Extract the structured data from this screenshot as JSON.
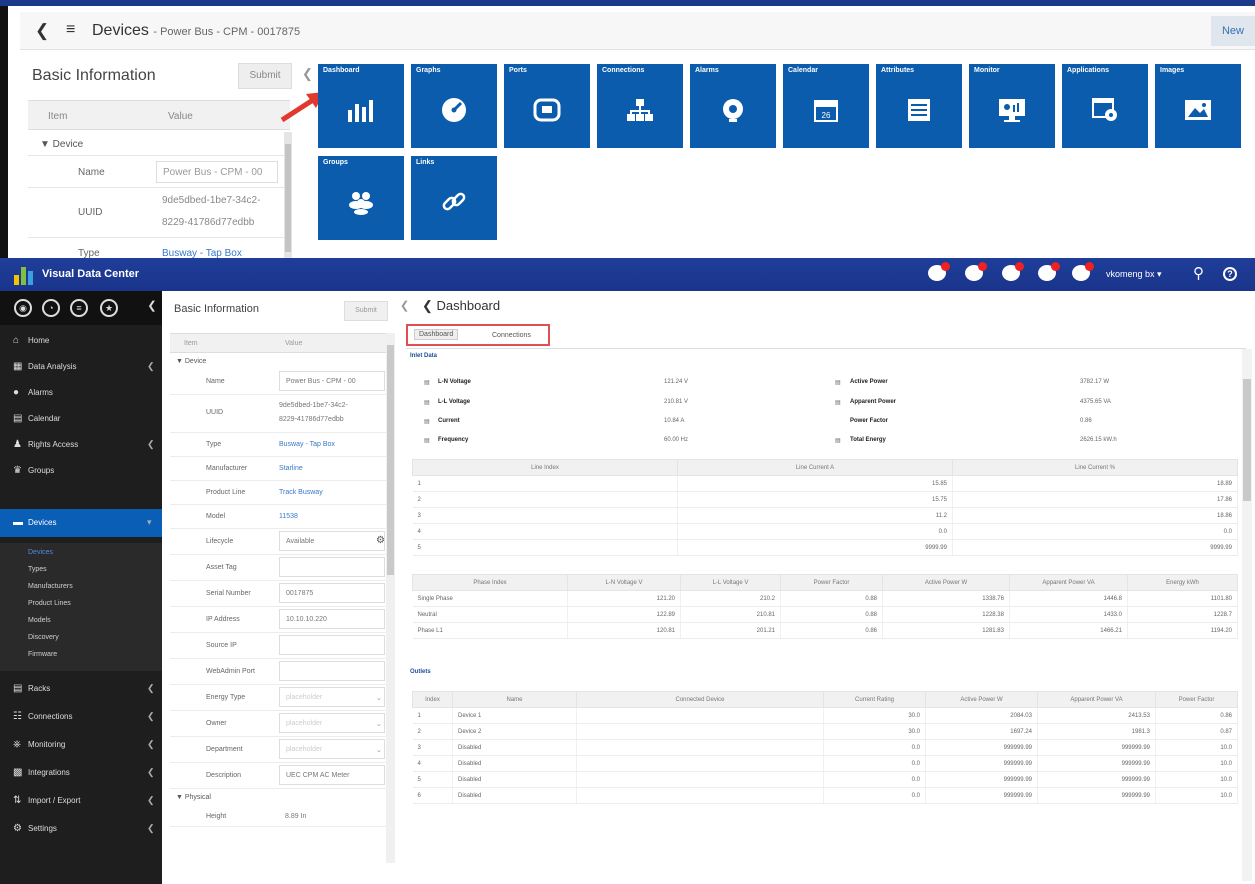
{
  "top_view": {
    "header": {
      "title": "Devices",
      "subtitle": "- Power Bus - CPM - 0017875",
      "new_label": "New"
    },
    "basic_info": {
      "title": "Basic Information",
      "submit_label": "Submit",
      "col_item": "Item",
      "col_value": "Value",
      "group_device": "▼ Device",
      "name_label": "Name",
      "name_value": "Power Bus - CPM - 00",
      "uuid_label": "UUID",
      "uuid_value_1": "9de5dbed-1be7-34c2-",
      "uuid_value_2": "8229-41786d77edbb",
      "type_label": "Type",
      "type_value": "Busway - Tap Box"
    },
    "tiles": [
      {
        "label": "Dashboard",
        "icon": "bar-chart-icon"
      },
      {
        "label": "Graphs",
        "icon": "gauge-icon"
      },
      {
        "label": "Ports",
        "icon": "port-icon"
      },
      {
        "label": "Connections",
        "icon": "hierarchy-icon"
      },
      {
        "label": "Alarms",
        "icon": "alarm-icon"
      },
      {
        "label": "Calendar",
        "icon": "calendar-icon"
      },
      {
        "label": "Attributes",
        "icon": "list-icon"
      },
      {
        "label": "Monitor",
        "icon": "monitor-icon"
      },
      {
        "label": "Applications",
        "icon": "app-settings-icon"
      },
      {
        "label": "Images",
        "icon": "image-icon"
      },
      {
        "label": "Groups",
        "icon": "groups-icon"
      },
      {
        "label": "Links",
        "icon": "link-icon"
      }
    ],
    "calendar_day": "26"
  },
  "app": {
    "name": "Visual Data Center",
    "user": "vkomeng bx"
  },
  "sidebar": {
    "items": [
      {
        "label": "Home",
        "icon": "home-icon"
      },
      {
        "label": "Data Analysis",
        "icon": "chart-icon"
      },
      {
        "label": "Alarms",
        "icon": "alarm-icon"
      },
      {
        "label": "Calendar",
        "icon": "calendar-icon"
      },
      {
        "label": "Rights Access",
        "icon": "user-icon"
      },
      {
        "label": "Groups",
        "icon": "groups-icon"
      },
      {
        "label": "Devices",
        "icon": "devices-icon"
      },
      {
        "label": "Racks",
        "icon": "rack-icon"
      },
      {
        "label": "Connections",
        "icon": "hierarchy-icon"
      },
      {
        "label": "Monitoring",
        "icon": "monitoring-icon"
      },
      {
        "label": "Integrations",
        "icon": "integrations-icon"
      },
      {
        "label": "Import / Export",
        "icon": "import-export-icon"
      },
      {
        "label": "Settings",
        "icon": "gear-icon"
      }
    ],
    "sub_items": [
      "Devices",
      "Types",
      "Manufacturers",
      "Product Lines",
      "Models",
      "Discovery",
      "Firmware"
    ]
  },
  "basic_info": {
    "title": "Basic Information",
    "submit_label": "Submit",
    "col_item": "Item",
    "col_value": "Value",
    "group_device": "▼ Device",
    "name_label": "Name",
    "name_value": "Power Bus - CPM - 00",
    "uuid_label": "UUID",
    "uuid_value_1": "9de5dbed-1be7-34c2-",
    "uuid_value_2": "8229-41786d77edbb",
    "type_label": "Type",
    "type_value": "Busway - Tap Box",
    "manufacturer_label": "Manufacturer",
    "manufacturer_value": "Starline",
    "product_line_label": "Product Line",
    "product_line_value": "Track Busway",
    "model_label": "Model",
    "model_value": "11538",
    "lifecycle_label": "Lifecycle",
    "lifecycle_value": "Available",
    "asset_tag_label": "Asset Tag",
    "serial_label": "Serial Number",
    "serial_value": "0017875",
    "ip_label": "IP Address",
    "ip_value": "10.10.10.220",
    "source_ip_label": "Source IP",
    "web_admin_label": "WebAdmin Port",
    "energy_type_label": "Energy Type",
    "energy_type_value": "placeholder",
    "owner_label": "Owner",
    "owner_value": "placeholder",
    "department_label": "Department",
    "department_value": "placeholder",
    "description_label": "Description",
    "description_value": "UEC CPM AC Meter",
    "group_physical": "▼ Physical",
    "height_label": "Height",
    "height_value": "8.89 In"
  },
  "dashboard": {
    "title": "Dashboard",
    "tabs": [
      "Dashboard",
      "Connections"
    ],
    "inlet_label": "Inlet Data",
    "inlet_left": [
      {
        "label": "L-N Voltage",
        "value": "121.24 V"
      },
      {
        "label": "L-L Voltage",
        "value": "210.81 V"
      },
      {
        "label": "Current",
        "value": "10.84 A"
      },
      {
        "label": "Frequency",
        "value": "60.00 Hz"
      }
    ],
    "inlet_right": [
      {
        "label": "Active Power",
        "value": "3782.17 W"
      },
      {
        "label": "Apparent Power",
        "value": "4375.65 VA"
      },
      {
        "label": "Power Factor",
        "value": "0.86"
      },
      {
        "label": "Total Energy",
        "value": "2626.15 kW.h"
      }
    ],
    "line_table": {
      "headers": [
        "Line Index",
        "Line Current A",
        "Line Current %"
      ],
      "rows": [
        [
          "1",
          "15.85",
          "18.89"
        ],
        [
          "2",
          "15.75",
          "17.86"
        ],
        [
          "3",
          "11.2",
          "18.86"
        ],
        [
          "4",
          "0.0",
          "0.0"
        ],
        [
          "5",
          "9999.99",
          "9999.99"
        ]
      ]
    },
    "phase_table": {
      "headers": [
        "Phase Index",
        "L-N Voltage V",
        "L-L Voltage V",
        "Power Factor",
        "Active Power W",
        "Apparent Power VA",
        "Energy kWh"
      ],
      "rows": [
        [
          "Single Phase",
          "121.20",
          "210.2",
          "0.88",
          "1338.76",
          "1446.8",
          "1101.80"
        ],
        [
          "Neutral",
          "122.89",
          "210.81",
          "0.88",
          "1228.38",
          "1433.0",
          "1228.7"
        ],
        [
          "Phase L1",
          "120.81",
          "201.21",
          "0.86",
          "1281.83",
          "1466.21",
          "1194.20"
        ]
      ]
    },
    "outlets_label": "Outlets",
    "outlets_table": {
      "headers": [
        "Index",
        "Name",
        "Connected Device",
        "Current Rating",
        "Active Power W",
        "Apparent Power VA",
        "Power Factor"
      ],
      "rows": [
        [
          "1",
          "Device 1",
          "",
          "30.0",
          "2084.03",
          "2413.53",
          "0.86"
        ],
        [
          "2",
          "Device 2",
          "",
          "30.0",
          "1697.24",
          "1981.3",
          "0.87"
        ],
        [
          "3",
          "Disabled",
          "",
          "0.0",
          "999999.99",
          "999999.99",
          "10.0"
        ],
        [
          "4",
          "Disabled",
          "",
          "0.0",
          "999999.99",
          "999999.99",
          "10.0"
        ],
        [
          "5",
          "Disabled",
          "",
          "0.0",
          "999999.99",
          "999999.99",
          "10.0"
        ],
        [
          "6",
          "Disabled",
          "",
          "0.0",
          "999999.99",
          "999999.99",
          "10.0"
        ]
      ]
    }
  }
}
